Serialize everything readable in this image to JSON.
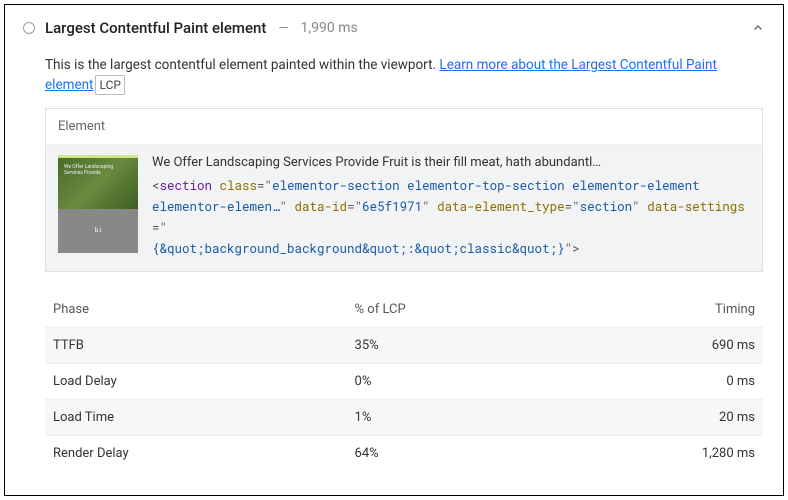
{
  "header": {
    "title": "Largest Contentful Paint element",
    "dash": "—",
    "timing": "1,990 ms"
  },
  "description": {
    "intro": "This is the largest contentful element painted within the viewport. ",
    "link_text": "Learn more about the Largest Contentful Paint element",
    "badge": "LCP"
  },
  "element_box": {
    "header": "Element",
    "snippet": "We Offer Landscaping Services Provide Fruit is their fill meat, hath abundantl…",
    "html_line1_pre": "<",
    "html_line1_tag": "section ",
    "html_line1_attr": "class",
    "html_line1_eq": "=\"",
    "html_line1_val": "elementor-section elementor-top-section elementor-element ",
    "html_line2_val": "elementor-elemen…",
    "html_line2_q": "\" ",
    "html_line2_attr1": "data-id",
    "html_line2_eq1": "=\"",
    "html_line2_val1": "6e5f1971",
    "html_line2_q1": "\" ",
    "html_line2_attr2": "data-element_type",
    "html_line2_eq2": "=\"",
    "html_line2_val2": "section",
    "html_line2_q2": "\" ",
    "html_line2_attr3": "data-settings",
    "html_line2_eq3": "=\"",
    "html_line3_val": "{&quot;background_background&quot;:&quot;classic&quot;}",
    "html_line3_close": "\">"
  },
  "phase_table": {
    "col_phase": "Phase",
    "col_pct": "% of LCP",
    "col_timing": "Timing",
    "rows": [
      {
        "phase": "TTFB",
        "pct": "35%",
        "timing": "690 ms"
      },
      {
        "phase": "Load Delay",
        "pct": "0%",
        "timing": "0 ms"
      },
      {
        "phase": "Load Time",
        "pct": "1%",
        "timing": "20 ms"
      },
      {
        "phase": "Render Delay",
        "pct": "64%",
        "timing": "1,280 ms"
      }
    ]
  }
}
